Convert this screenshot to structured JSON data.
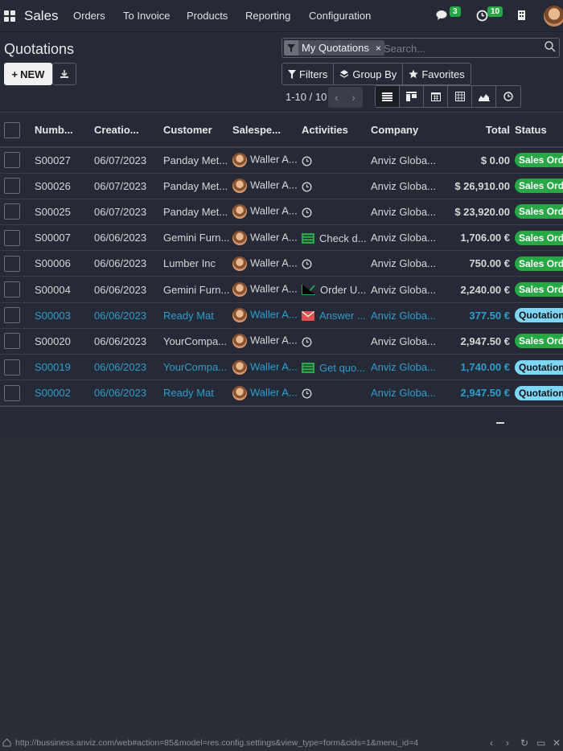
{
  "navbar": {
    "brand": "Sales",
    "menu": [
      "Orders",
      "To Invoice",
      "Products",
      "Reporting",
      "Configuration"
    ],
    "messages_count": "3",
    "activities_count": "10"
  },
  "control": {
    "title": "Quotations",
    "new_label": "NEW",
    "search": {
      "facet": "My Quotations",
      "placeholder": "Search..."
    },
    "filters_label": "Filters",
    "groupby_label": "Group By",
    "favorites_label": "Favorites",
    "pager": "1-10 / 10"
  },
  "table": {
    "headers": [
      "Numb...",
      "Creatio...",
      "Customer",
      "Salespe...",
      "Activities",
      "Company",
      "Total",
      "Status"
    ],
    "rows": [
      {
        "number": "S00027",
        "date": "06/07/2023",
        "customer": "Panday Met...",
        "salesperson": "Waller A...",
        "activity_icon": "clock-icon",
        "activity": "",
        "company": "Anviz Globa...",
        "total": "$ 0.00",
        "status": "Sales Order",
        "kind": "order"
      },
      {
        "number": "S00026",
        "date": "06/07/2023",
        "customer": "Panday Met...",
        "salesperson": "Waller A...",
        "activity_icon": "clock-icon",
        "activity": "",
        "company": "Anviz Globa...",
        "total": "$ 26,910.00",
        "status": "Sales Order",
        "kind": "order"
      },
      {
        "number": "S00025",
        "date": "06/07/2023",
        "customer": "Panday Met...",
        "salesperson": "Waller A...",
        "activity_icon": "clock-icon",
        "activity": "",
        "company": "Anviz Globa...",
        "total": "$ 23,920.00",
        "status": "Sales Order",
        "kind": "order"
      },
      {
        "number": "S00007",
        "date": "06/06/2023",
        "customer": "Gemini Furn...",
        "salesperson": "Waller A...",
        "activity_icon": "list-icon",
        "activity": "Check d...",
        "company": "Anviz Globa...",
        "total": "1,706.00 €",
        "status": "Sales Order",
        "kind": "order"
      },
      {
        "number": "S00006",
        "date": "06/06/2023",
        "customer": "Lumber Inc",
        "salesperson": "Waller A...",
        "activity_icon": "clock-icon",
        "activity": "",
        "company": "Anviz Globa...",
        "total": "750.00 €",
        "status": "Sales Order",
        "kind": "order"
      },
      {
        "number": "S00004",
        "date": "06/06/2023",
        "customer": "Gemini Furn...",
        "salesperson": "Waller A...",
        "activity_icon": "chart-icon",
        "activity": "Order U...",
        "company": "Anviz Globa...",
        "total": "2,240.00 €",
        "status": "Sales Order",
        "kind": "order"
      },
      {
        "number": "S00003",
        "date": "06/06/2023",
        "customer": "Ready Mat",
        "salesperson": "Waller A...",
        "activity_icon": "envelope-icon",
        "activity": "Answer ...",
        "company": "Anviz Globa...",
        "total": "377.50 €",
        "status": "Quotation",
        "kind": "quote"
      },
      {
        "number": "S00020",
        "date": "06/06/2023",
        "customer": "YourCompa...",
        "salesperson": "Waller A...",
        "activity_icon": "clock-icon",
        "activity": "",
        "company": "Anviz Globa...",
        "total": "2,947.50 €",
        "status": "Sales Order",
        "kind": "order"
      },
      {
        "number": "S00019",
        "date": "06/06/2023",
        "customer": "YourCompa...",
        "salesperson": "Waller A...",
        "activity_icon": "list-icon",
        "activity": "Get quo...",
        "company": "Anviz Globa...",
        "total": "1,740.00 €",
        "status": "Quotation Sent",
        "kind": "quote"
      },
      {
        "number": "S00002",
        "date": "06/06/2023",
        "customer": "Ready Mat",
        "salesperson": "Waller A...",
        "activity_icon": "clock-icon",
        "activity": "",
        "company": "Anviz Globa...",
        "total": "2,947.50 €",
        "status": "Quotation",
        "kind": "quote"
      }
    ]
  },
  "statusbar": {
    "url": "http://bussiness.anviz.com/web#action=85&model=res.config.settings&view_type=form&cids=1&menu_id=4"
  },
  "colors": {
    "sales_order": "#28a745",
    "quotation": "#7ed6f4",
    "quote_text": "#2f9ccc",
    "background": "#2b2d37"
  }
}
